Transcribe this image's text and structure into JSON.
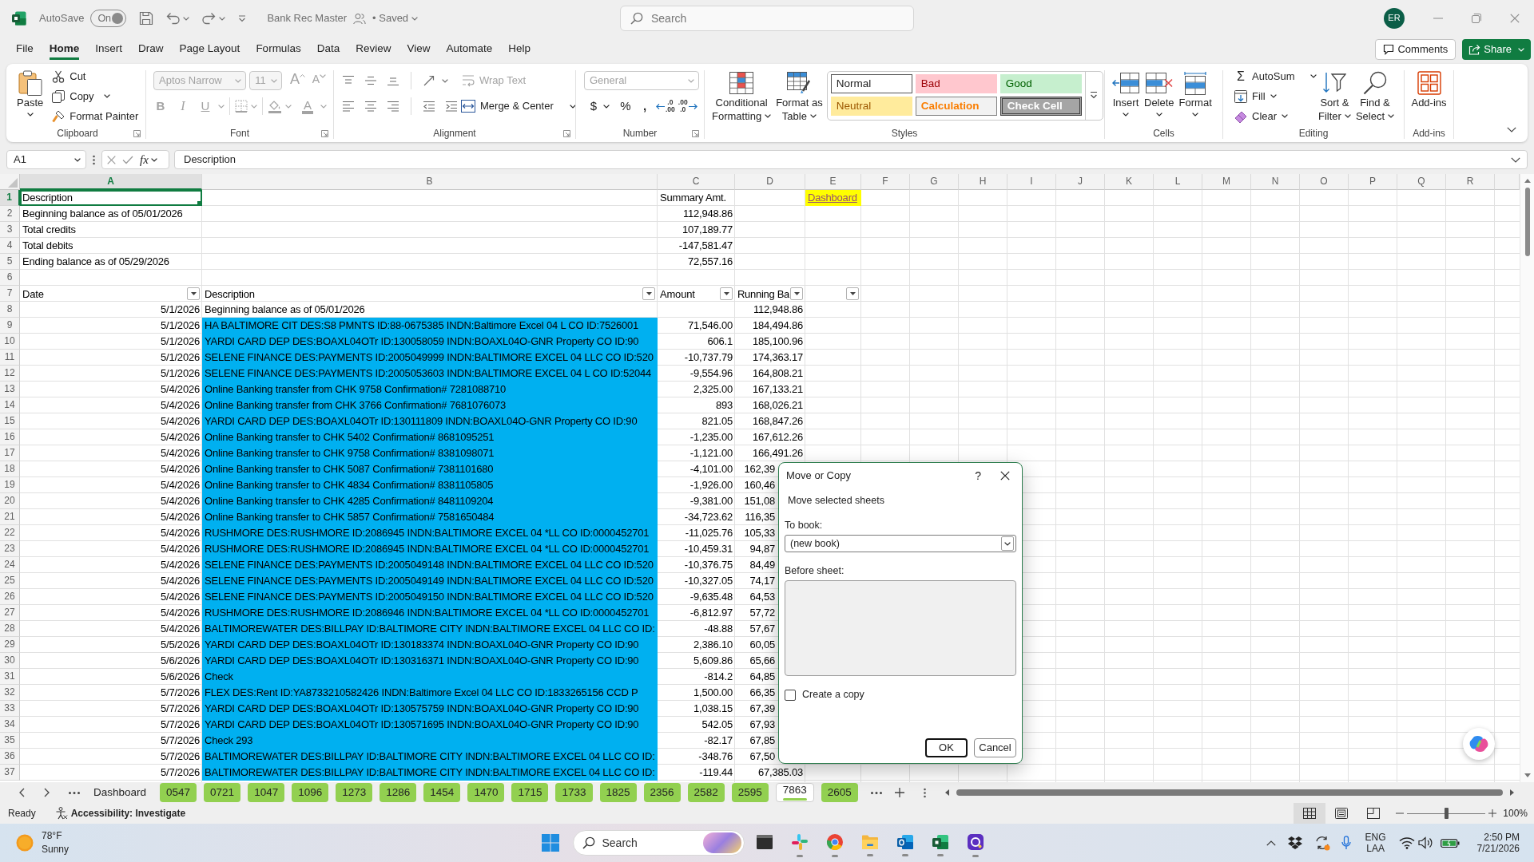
{
  "title_bar": {
    "autosave_label": "AutoSave",
    "autosave_toggle": {
      "text": "On",
      "on": true
    },
    "document_title": "Bank Rec Master",
    "save_status": "• Saved",
    "search": {
      "placeholder": "Search"
    },
    "avatar_initials": "ER"
  },
  "ribbon_tabs": [
    {
      "label": "File",
      "selected": false
    },
    {
      "label": "Home",
      "selected": true
    },
    {
      "label": "Insert",
      "selected": false
    },
    {
      "label": "Draw",
      "selected": false
    },
    {
      "label": "Page Layout",
      "selected": false
    },
    {
      "label": "Formulas",
      "selected": false
    },
    {
      "label": "Data",
      "selected": false
    },
    {
      "label": "Review",
      "selected": false
    },
    {
      "label": "View",
      "selected": false
    },
    {
      "label": "Automate",
      "selected": false
    },
    {
      "label": "Help",
      "selected": false
    }
  ],
  "header_buttons": {
    "comments": "Comments",
    "share": "Share"
  },
  "ribbon": {
    "clipboard": {
      "label": "Clipboard",
      "paste": "Paste",
      "cut": "Cut",
      "copy": "Copy",
      "format_painter": "Format Painter"
    },
    "font": {
      "label": "Font",
      "disabled": true,
      "font_name": "Aptos Narrow",
      "font_size": "11",
      "grow_font": "A",
      "shrink_font": "A",
      "bold": "B",
      "italic": "I",
      "underline": "U",
      "font_color": "A"
    },
    "alignment": {
      "label": "Alignment",
      "wrap_text": {
        "text": "Wrap Text",
        "disabled": true
      },
      "merge_center": "Merge & Center"
    },
    "number": {
      "label": "Number",
      "format": {
        "value": "General",
        "disabled": true
      },
      "currency": "$",
      "percent": "%",
      "comma_style": ",",
      "increase_decimal": [
        ".0",
        ".00"
      ],
      "decrease_decimal": [
        ".00",
        ".0"
      ]
    },
    "styles": {
      "label": "Styles",
      "conditional_formatting": [
        "Conditional",
        "Formatting"
      ],
      "format_as_table": [
        "Format as",
        "Table"
      ],
      "cell_styles": [
        {
          "name": "Normal",
          "kind": "normal",
          "selected": true
        },
        {
          "name": "Bad",
          "kind": "bad",
          "selected": false
        },
        {
          "name": "Good",
          "kind": "good",
          "selected": false
        },
        {
          "name": "Neutral",
          "kind": "neutral",
          "selected": false
        },
        {
          "name": "Calculation",
          "kind": "calculation",
          "selected": false
        },
        {
          "name": "Check Cell",
          "kind": "check",
          "selected": false
        }
      ]
    },
    "cells": {
      "label": "Cells",
      "buttons": [
        {
          "label": "Insert",
          "kind": "insert"
        },
        {
          "label": "Delete",
          "kind": "delete"
        },
        {
          "label": "Format",
          "kind": "format"
        }
      ]
    },
    "editing": {
      "label": "Editing",
      "autosum": {
        "symbol": "Σ",
        "label": "AutoSum"
      },
      "fill": "Fill",
      "clear": "Clear",
      "sort_filter": [
        "Sort &",
        "Filter"
      ],
      "find_select": [
        "Find &",
        "Select"
      ]
    },
    "add_ins": {
      "label": "Add-ins",
      "button": "Add-ins"
    }
  },
  "formula_bar": {
    "name_box": "A1",
    "function_label": "fx",
    "formula": "Description"
  },
  "sheet": {
    "columns": [
      {
        "label": "A",
        "selected": true
      },
      {
        "label": "B",
        "selected": false
      },
      {
        "label": "C",
        "selected": false
      },
      {
        "label": "D",
        "selected": false
      },
      {
        "label": "E",
        "selected": false
      },
      {
        "label": "F",
        "selected": false
      },
      {
        "label": "G",
        "selected": false
      },
      {
        "label": "H",
        "selected": false
      },
      {
        "label": "I",
        "selected": false
      },
      {
        "label": "J",
        "selected": false
      },
      {
        "label": "K",
        "selected": false
      },
      {
        "label": "L",
        "selected": false
      },
      {
        "label": "M",
        "selected": false
      },
      {
        "label": "N",
        "selected": false
      },
      {
        "label": "O",
        "selected": false
      },
      {
        "label": "P",
        "selected": false
      },
      {
        "label": "Q",
        "selected": false
      },
      {
        "label": "R",
        "selected": false
      }
    ],
    "rows": [
      {
        "number": "1",
        "selected": true,
        "kind": "summary_title",
        "label": "Description",
        "value": "Summary Amt.",
        "link": {
          "text": "Dashboard",
          "color": "#ffff00"
        }
      },
      {
        "number": "2",
        "selected": false,
        "kind": "summary",
        "label": "Beginning balance as of 05/01/2026",
        "value": "112,948.86"
      },
      {
        "number": "3",
        "selected": false,
        "kind": "summary",
        "label": "Total credits",
        "value": "107,189.77"
      },
      {
        "number": "4",
        "selected": false,
        "kind": "summary",
        "label": "Total debits",
        "value": "-147,581.47"
      },
      {
        "number": "5",
        "selected": false,
        "kind": "summary",
        "label": "Ending balance as of 05/29/2026",
        "value": "72,557.16"
      },
      {
        "number": "6",
        "selected": false,
        "kind": "blank"
      },
      {
        "number": "7",
        "selected": false,
        "kind": "header",
        "headers": [
          {
            "text": "Date",
            "filter": true
          },
          {
            "text": "Description",
            "filter": true
          },
          {
            "text": "Amount",
            "filter": true
          },
          {
            "text": "Running Ba",
            "filter": true
          },
          {
            "filter": true
          }
        ]
      },
      {
        "number": "8",
        "selected": false,
        "kind": "entry",
        "date": "5/1/2026",
        "description": "Beginning balance as of 05/01/2026",
        "balance": "112,948.86"
      },
      {
        "number": "9",
        "selected": false,
        "kind": "entry",
        "date": "5/1/2026",
        "description": "HA BALTIMORE CIT DES:S8 PMNTS ID:88-0675385 INDN:Baltimore Excel 04 L CO ID:7526001",
        "amount": "71,546.00",
        "balance": "184,494.86",
        "color": "#00b0f0"
      },
      {
        "number": "10",
        "selected": false,
        "kind": "entry",
        "date": "5/1/2026",
        "description": "YARDI CARD DEP DES:BOAXL04OTr ID:130058059 INDN:BOAXL04O-GNR Property CO ID:90",
        "amount": "606.1",
        "balance": "185,100.96",
        "color": "#00b0f0"
      },
      {
        "number": "11",
        "selected": false,
        "kind": "entry",
        "date": "5/1/2026",
        "description": "SELENE FINANCE DES:PAYMENTS ID:2005049999 INDN:BALTIMORE EXCEL 04 LLC CO ID:520",
        "amount": "-10,737.79",
        "balance": "174,363.17",
        "color": "#00b0f0"
      },
      {
        "number": "12",
        "selected": false,
        "kind": "entry",
        "date": "5/1/2026",
        "description": "SELENE FINANCE DES:PAYMENTS ID:2005053603 INDN:BALTIMORE EXCEL 04 L CO ID:52044",
        "amount": "-9,554.96",
        "balance": "164,808.21",
        "color": "#00b0f0"
      },
      {
        "number": "13",
        "selected": false,
        "kind": "entry",
        "date": "5/4/2026",
        "description": "Online Banking transfer from CHK 9758 Confirmation# 7281088710",
        "amount": "2,325.00",
        "balance": "167,133.21",
        "color": "#00b0f0"
      },
      {
        "number": "14",
        "selected": false,
        "kind": "entry",
        "date": "5/4/2026",
        "description": "Online Banking transfer from CHK 3766 Confirmation# 7681076073",
        "amount": "893",
        "balance": "168,026.21",
        "color": "#00b0f0"
      },
      {
        "number": "15",
        "selected": false,
        "kind": "entry",
        "date": "5/4/2026",
        "description": "YARDI CARD DEP DES:BOAXL04OTr ID:130111809 INDN:BOAXL04O-GNR Property CO ID:90",
        "amount": "821.05",
        "balance": "168,847.26",
        "color": "#00b0f0"
      },
      {
        "number": "16",
        "selected": false,
        "kind": "entry",
        "date": "5/4/2026",
        "description": "Online Banking transfer to CHK 5402 Confirmation# 8681095251",
        "amount": "-1,235.00",
        "balance": "167,612.26",
        "color": "#00b0f0"
      },
      {
        "number": "17",
        "selected": false,
        "kind": "entry",
        "date": "5/4/2026",
        "description": "Online Banking transfer to CHK 9758 Confirmation# 8381098071",
        "amount": "-1,121.00",
        "balance": "166,491.26",
        "color": "#00b0f0"
      },
      {
        "number": "18",
        "selected": false,
        "kind": "entry",
        "date": "5/4/2026",
        "description": "Online Banking transfer to CHK 5087 Confirmation# 7381101680",
        "amount": "-4,101.00",
        "balance": "162,39",
        "color": "#00b0f0"
      },
      {
        "number": "19",
        "selected": false,
        "kind": "entry",
        "date": "5/4/2026",
        "description": "Online Banking transfer to CHK 4834 Confirmation# 8381105805",
        "amount": "-1,926.00",
        "balance": "160,46",
        "color": "#00b0f0"
      },
      {
        "number": "20",
        "selected": false,
        "kind": "entry",
        "date": "5/4/2026",
        "description": "Online Banking transfer to CHK 4285 Confirmation# 8481109204",
        "amount": "-9,381.00",
        "balance": "151,08",
        "color": "#00b0f0"
      },
      {
        "number": "21",
        "selected": false,
        "kind": "entry",
        "date": "5/4/2026",
        "description": "Online Banking transfer to CHK 5857 Confirmation# 7581650484",
        "amount": "-34,723.62",
        "balance": "116,35",
        "color": "#00b0f0"
      },
      {
        "number": "22",
        "selected": false,
        "kind": "entry",
        "date": "5/4/2026",
        "description": "RUSHMORE DES:RUSHMORE ID:2086945 INDN:BALTIMORE EXCEL 04 *LL CO ID:0000452701",
        "amount": "-11,025.76",
        "balance": "105,33",
        "color": "#00b0f0"
      },
      {
        "number": "23",
        "selected": false,
        "kind": "entry",
        "date": "5/4/2026",
        "description": "RUSHMORE DES:RUSHMORE ID:2086945 INDN:BALTIMORE EXCEL 04 *LL CO ID:0000452701",
        "amount": "-10,459.31",
        "balance": "94,87",
        "color": "#00b0f0"
      },
      {
        "number": "24",
        "selected": false,
        "kind": "entry",
        "date": "5/4/2026",
        "description": "SELENE FINANCE DES:PAYMENTS ID:2005049148 INDN:BALTIMORE EXCEL 04 LLC CO ID:520",
        "amount": "-10,376.75",
        "balance": "84,49",
        "color": "#00b0f0"
      },
      {
        "number": "25",
        "selected": false,
        "kind": "entry",
        "date": "5/4/2026",
        "description": "SELENE FINANCE DES:PAYMENTS ID:2005049149 INDN:BALTIMORE EXCEL 04 LLC CO ID:520",
        "amount": "-10,327.05",
        "balance": "74,17",
        "color": "#00b0f0"
      },
      {
        "number": "26",
        "selected": false,
        "kind": "entry",
        "date": "5/4/2026",
        "description": "SELENE FINANCE DES:PAYMENTS ID:2005049150 INDN:BALTIMORE EXCEL 04 LLC CO ID:520",
        "amount": "-9,635.48",
        "balance": "64,53",
        "color": "#00b0f0"
      },
      {
        "number": "27",
        "selected": false,
        "kind": "entry",
        "date": "5/4/2026",
        "description": "RUSHMORE DES:RUSHMORE ID:2086946 INDN:BALTIMORE EXCEL 04 *LL CO ID:0000452701",
        "amount": "-6,812.97",
        "balance": "57,72",
        "color": "#00b0f0"
      },
      {
        "number": "28",
        "selected": false,
        "kind": "entry",
        "date": "5/4/2026",
        "description": "BALTIMOREWATER DES:BILLPAY ID:BALTIMORE CITY INDN:BALTIMORE EXCEL 04 LLC CO ID:",
        "amount": "-48.88",
        "balance": "57,67",
        "color": "#00b0f0"
      },
      {
        "number": "29",
        "selected": false,
        "kind": "entry",
        "date": "5/5/2026",
        "description": "YARDI CARD DEP DES:BOAXL04OTr ID:130183374 INDN:BOAXL04O-GNR Property CO ID:90",
        "amount": "2,386.10",
        "balance": "60,05",
        "color": "#00b0f0"
      },
      {
        "number": "30",
        "selected": false,
        "kind": "entry",
        "date": "5/6/2026",
        "description": "YARDI CARD DEP DES:BOAXL04OTr ID:130316371 INDN:BOAXL04O-GNR Property CO ID:90",
        "amount": "5,609.86",
        "balance": "65,66",
        "color": "#00b0f0"
      },
      {
        "number": "31",
        "selected": false,
        "kind": "entry",
        "date": "5/6/2026",
        "description": "Check",
        "amount": "-814.2",
        "balance": "64,85",
        "color": "#00b0f0"
      },
      {
        "number": "32",
        "selected": false,
        "kind": "entry",
        "date": "5/7/2026",
        "description": "FLEX DES:Rent ID:YA8733210582426 INDN:Baltimore Excel 04 LLC CO ID:1833265156 CCD P",
        "amount": "1,500.00",
        "balance": "66,35",
        "color": "#00b0f0"
      },
      {
        "number": "33",
        "selected": false,
        "kind": "entry",
        "date": "5/7/2026",
        "description": "YARDI CARD DEP DES:BOAXL04OTr ID:130575759 INDN:BOAXL04O-GNR Property CO ID:90",
        "amount": "1,038.15",
        "balance": "67,39",
        "color": "#00b0f0"
      },
      {
        "number": "34",
        "selected": false,
        "kind": "entry",
        "date": "5/7/2026",
        "description": "YARDI CARD DEP DES:BOAXL04OTr ID:130571695 INDN:BOAXL04O-GNR Property CO ID:90",
        "amount": "542.05",
        "balance": "67,93",
        "color": "#00b0f0"
      },
      {
        "number": "35",
        "selected": false,
        "kind": "entry",
        "date": "5/7/2026",
        "description": "Check 293",
        "amount": "-82.17",
        "balance": "67,85",
        "color": "#00b0f0"
      },
      {
        "number": "36",
        "selected": false,
        "kind": "entry",
        "date": "5/7/2026",
        "description": "BALTIMOREWATER DES:BILLPAY ID:BALTIMORE CITY INDN:BALTIMORE EXCEL 04 LLC CO ID:",
        "amount": "-348.76",
        "balance": "67,50",
        "color": "#00b0f0"
      },
      {
        "number": "37",
        "selected": false,
        "kind": "entry",
        "date": "5/7/2026",
        "description": "BALTIMOREWATER DES:BILLPAY ID:BALTIMORE CITY INDN:BALTIMORE EXCEL 04 LLC CO ID:",
        "amount": "-119.44",
        "balance": "67,385.03",
        "color": "#00b0f0"
      }
    ]
  },
  "dialog": {
    "title": "Move or Copy",
    "help": "?",
    "heading": "Move selected sheets",
    "to_book": {
      "label": "To book:",
      "value": "(new book)"
    },
    "before_sheet": {
      "label": "Before sheet:"
    },
    "create_copy": {
      "label": "Create a copy",
      "checked": false
    },
    "buttons": [
      {
        "label": "OK",
        "default": true
      },
      {
        "label": "Cancel",
        "default": false
      }
    ]
  },
  "sheet_tabs": [
    {
      "label": "Dashboard",
      "selected": false
    },
    {
      "label": "0547",
      "color": "#92d050",
      "selected": false
    },
    {
      "label": "0721",
      "color": "#92d050",
      "selected": false
    },
    {
      "label": "1047",
      "color": "#92d050",
      "selected": false
    },
    {
      "label": "1096",
      "color": "#92d050",
      "selected": false
    },
    {
      "label": "1273",
      "color": "#92d050",
      "selected": false
    },
    {
      "label": "1286",
      "color": "#92d050",
      "selected": false
    },
    {
      "label": "1454",
      "color": "#92d050",
      "selected": false
    },
    {
      "label": "1470",
      "color": "#92d050",
      "selected": false
    },
    {
      "label": "1715",
      "color": "#92d050",
      "selected": false
    },
    {
      "label": "1733",
      "color": "#92d050",
      "selected": false
    },
    {
      "label": "1825",
      "color": "#92d050",
      "selected": false
    },
    {
      "label": "2356",
      "color": "#92d050",
      "selected": false
    },
    {
      "label": "2582",
      "color": "#92d050",
      "selected": false
    },
    {
      "label": "2595",
      "color": "#92d050",
      "selected": false
    },
    {
      "label": "7863",
      "color": "#92d050",
      "selected": true
    },
    {
      "label": "2605",
      "color": "#92d050",
      "selected": false
    }
  ],
  "status_bar": {
    "status": "Ready",
    "accessibility": "Accessibility: Investigate",
    "views": [
      {
        "kind": "normal",
        "selected": true
      },
      {
        "kind": "page_layout",
        "selected": false
      },
      {
        "kind": "page_break",
        "selected": false
      }
    ],
    "zoom": {
      "level": 0.5,
      "text": "100%"
    }
  },
  "taskbar": {
    "weather": {
      "temperature": "78°F",
      "condition": "Sunny"
    },
    "search": {
      "placeholder": "Search"
    },
    "apps": [
      {
        "kind": "window",
        "running": false
      },
      {
        "kind": "pinwheel",
        "running": true
      },
      {
        "kind": "browser",
        "running": true
      },
      {
        "kind": "folder",
        "running": true
      },
      {
        "kind": "mail",
        "running": true
      },
      {
        "kind": "spreadsheet",
        "running": true
      },
      {
        "kind": "app",
        "running": true
      }
    ],
    "tray": {
      "language": [
        "ENG",
        "LAA"
      ],
      "time": "2:50 PM",
      "date": "7/21/2026"
    }
  }
}
